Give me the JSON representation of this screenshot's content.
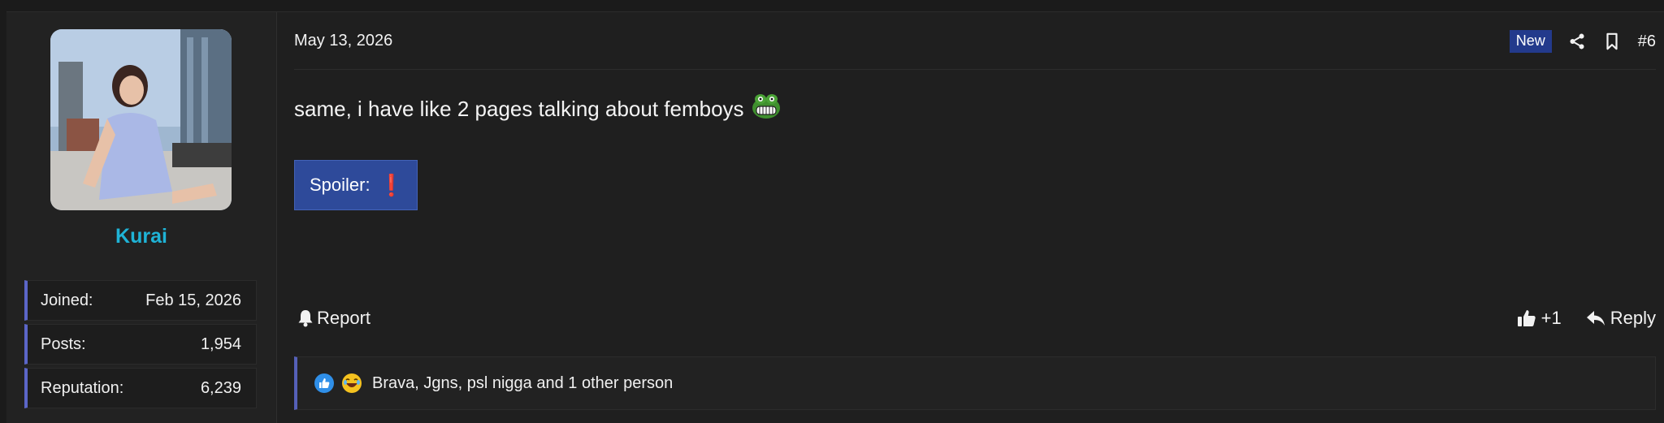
{
  "post": {
    "date": "May 13, 2026",
    "badge": "New",
    "post_number": "#6",
    "text": "same, i have like 2 pages talking about femboys",
    "spoiler_label": "Spoiler:",
    "spoiler_mark": "❗",
    "report_label": "Report",
    "like_label": "+1",
    "reply_label": "Reply",
    "reactions_text": "Brava, Jgns, psl nigga and 1 other person"
  },
  "user": {
    "name": "Kurai",
    "stats": [
      {
        "label": "Joined:",
        "value": "Feb 15, 2026"
      },
      {
        "label": "Posts:",
        "value": "1,954"
      },
      {
        "label": "Reputation:",
        "value": "6,239"
      }
    ]
  },
  "colors": {
    "username": "#1fb3d6",
    "badge_bg": "#233a8c",
    "spoiler_bg": "#2e4a9a",
    "accent_border": "#5b66c8"
  },
  "icons": {
    "share": "share-icon",
    "bookmark": "bookmark-icon",
    "bell": "bell-icon",
    "like": "thumbs-up-icon",
    "reply": "reply-icon",
    "frog_emoji": "frog-emoji-icon",
    "reaction_like": "like-reaction-icon",
    "reaction_laugh": "laugh-reaction-icon"
  }
}
